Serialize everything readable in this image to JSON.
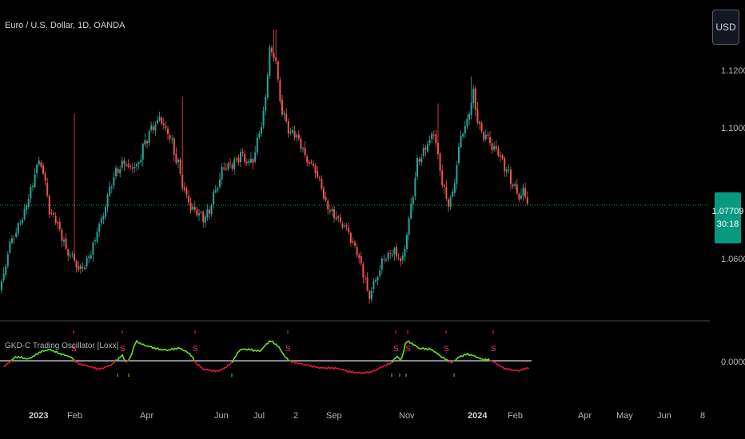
{
  "header": {
    "symbol_title": "Euro / U.S. Dollar, 1D, OANDA",
    "currency_button": "USD"
  },
  "last_price": {
    "value": "1.07709",
    "countdown": "30:18",
    "color": "#089981"
  },
  "indicator": {
    "title": "GKD-C Trading Oscillator [Loxx]"
  },
  "colors": {
    "background": "#000000",
    "up_candle": "#26a69a",
    "down_candle": "#ef5350",
    "osc_bull": "#66e01a",
    "osc_bear": "#e0173f",
    "zero_line": "#b2b5be",
    "signal": "#ff3355",
    "buy_signal": "#66e01a"
  },
  "chart_data": [
    {
      "type": "candlestick",
      "title": "Euro / U.S. Dollar, 1D, OANDA",
      "x_labels": [
        "2023",
        "Feb",
        "Apr",
        "Jun",
        "Jul",
        "2",
        "Sep",
        "Nov",
        "2024",
        "Feb",
        "Apr",
        "May",
        "Jun",
        "8"
      ],
      "y_ticks": [
        "1.12000",
        "1.10000",
        "1.06000"
      ],
      "ylim": [
        1.043,
        1.132
      ],
      "last_price": 1.07709,
      "close_anchors": [
        [
          0,
          1.0505
        ],
        [
          12,
          1.064
        ],
        [
          25,
          1.07
        ],
        [
          40,
          1.081
        ],
        [
          50,
          1.09
        ],
        [
          57,
          1.082
        ],
        [
          62,
          1.074
        ],
        [
          72,
          1.07
        ],
        [
          85,
          1.062
        ],
        [
          100,
          1.056
        ],
        [
          115,
          1.062
        ],
        [
          125,
          1.07
        ],
        [
          140,
          1.083
        ],
        [
          155,
          1.089
        ],
        [
          170,
          1.086
        ],
        [
          185,
          1.097
        ],
        [
          200,
          1.101
        ],
        [
          210,
          1.098
        ],
        [
          220,
          1.09
        ],
        [
          232,
          1.079
        ],
        [
          245,
          1.073
        ],
        [
          258,
          1.072
        ],
        [
          270,
          1.08
        ],
        [
          282,
          1.088
        ],
        [
          292,
          1.088
        ],
        [
          302,
          1.091
        ],
        [
          312,
          1.088
        ],
        [
          320,
          1.092
        ],
        [
          330,
          1.103
        ],
        [
          338,
          1.123
        ],
        [
          345,
          1.118
        ],
        [
          352,
          1.104
        ],
        [
          362,
          1.098
        ],
        [
          372,
          1.096
        ],
        [
          385,
          1.089
        ],
        [
          395,
          1.086
        ],
        [
          410,
          1.075
        ],
        [
          422,
          1.071
        ],
        [
          432,
          1.07
        ],
        [
          442,
          1.064
        ],
        [
          452,
          1.058
        ],
        [
          462,
          1.049
        ],
        [
          470,
          1.053
        ],
        [
          480,
          1.06
        ],
        [
          492,
          1.062
        ],
        [
          502,
          1.058
        ],
        [
          512,
          1.072
        ],
        [
          522,
          1.088
        ],
        [
          532,
          1.093
        ],
        [
          542,
          1.098
        ],
        [
          550,
          1.087
        ],
        [
          558,
          1.077
        ],
        [
          566,
          1.078
        ],
        [
          575,
          1.094
        ],
        [
          585,
          1.102
        ],
        [
          592,
          1.109
        ],
        [
          600,
          1.098
        ],
        [
          610,
          1.096
        ],
        [
          620,
          1.092
        ],
        [
          630,
          1.088
        ],
        [
          640,
          1.083
        ],
        [
          648,
          1.078
        ],
        [
          655,
          1.079
        ],
        [
          662,
          1.0771
        ]
      ],
      "high_points": [
        [
          93,
          1.103
        ],
        [
          229,
          1.108
        ],
        [
          344,
          1.128
        ],
        [
          590,
          1.114
        ],
        [
          547,
          1.106
        ]
      ]
    },
    {
      "type": "line",
      "title": "GKD-C Trading Oscillator [Loxx]",
      "y_ticks": [
        "0.00000"
      ],
      "zero_level": 0,
      "anchors": [
        [
          5,
          -0.15
        ],
        [
          20,
          0.1
        ],
        [
          35,
          0.05
        ],
        [
          50,
          0.25
        ],
        [
          62,
          0.3
        ],
        [
          75,
          0.2
        ],
        [
          85,
          0.15
        ],
        [
          92,
          0.05
        ],
        [
          98,
          -0.1
        ],
        [
          110,
          -0.15
        ],
        [
          125,
          -0.22
        ],
        [
          140,
          -0.12
        ],
        [
          148,
          0.05
        ],
        [
          153,
          0.15
        ],
        [
          158,
          -0.05
        ],
        [
          163,
          0.1
        ],
        [
          170,
          0.55
        ],
        [
          180,
          0.42
        ],
        [
          195,
          0.35
        ],
        [
          210,
          0.3
        ],
        [
          225,
          0.34
        ],
        [
          238,
          0.2
        ],
        [
          245,
          -0.05
        ],
        [
          255,
          -0.25
        ],
        [
          270,
          -0.3
        ],
        [
          280,
          -0.2
        ],
        [
          290,
          -0.05
        ],
        [
          300,
          0.3
        ],
        [
          312,
          0.32
        ],
        [
          325,
          0.28
        ],
        [
          338,
          0.55
        ],
        [
          348,
          0.4
        ],
        [
          358,
          0.08
        ],
        [
          365,
          -0.02
        ],
        [
          380,
          -0.12
        ],
        [
          400,
          -0.18
        ],
        [
          420,
          -0.22
        ],
        [
          440,
          -0.3
        ],
        [
          455,
          -0.35
        ],
        [
          465,
          -0.32
        ],
        [
          478,
          -0.15
        ],
        [
          490,
          -0.05
        ],
        [
          497,
          0.12
        ],
        [
          502,
          -0.02
        ],
        [
          508,
          0.55
        ],
        [
          515,
          0.5
        ],
        [
          525,
          0.35
        ],
        [
          540,
          0.3
        ],
        [
          550,
          0.15
        ],
        [
          558,
          0.05
        ],
        [
          565,
          -0.05
        ],
        [
          575,
          0.1
        ],
        [
          585,
          0.18
        ],
        [
          594,
          0.14
        ],
        [
          603,
          0.05
        ],
        [
          612,
          0.02
        ],
        [
          618,
          -0.05
        ],
        [
          630,
          -0.2
        ],
        [
          642,
          -0.25
        ],
        [
          650,
          -0.28
        ],
        [
          662,
          -0.2
        ]
      ],
      "sell_signals_x": [
        92,
        153,
        244,
        360,
        495,
        510,
        558,
        617
      ],
      "buy_signals_x": [
        147,
        161,
        290,
        490,
        500,
        508,
        568
      ]
    }
  ]
}
